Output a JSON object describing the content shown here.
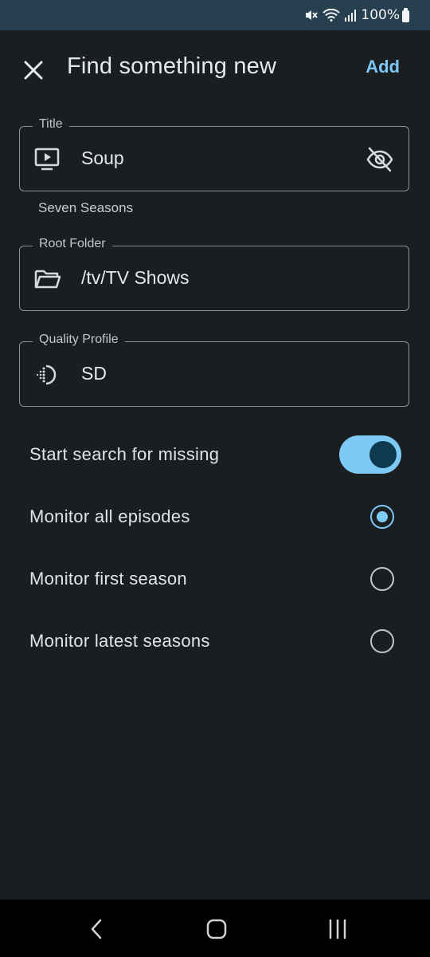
{
  "status_bar": {
    "battery_text": "100%",
    "icons": [
      "mute-icon",
      "wifi-icon",
      "signal-icon",
      "battery-icon"
    ]
  },
  "app_bar": {
    "title": "Find something new",
    "add_label": "Add",
    "close_icon": "close-icon"
  },
  "form": {
    "title_field": {
      "label": "Title",
      "value": "Soup",
      "helper": "Seven Seasons",
      "icon": "tv-play-icon",
      "trailing_icon": "eye-off-icon"
    },
    "root_folder": {
      "label": "Root Folder",
      "value": "/tv/TV Shows",
      "icon": "folder-icon"
    },
    "quality_profile": {
      "label": "Quality Profile",
      "value": "SD",
      "icon": "quality-icon"
    }
  },
  "options": {
    "search_missing": {
      "label": "Start search for missing",
      "enabled": true
    },
    "monitor": [
      {
        "label": "Monitor all episodes",
        "selected": true
      },
      {
        "label": "Monitor first season",
        "selected": false
      },
      {
        "label": "Monitor latest seasons",
        "selected": false
      }
    ]
  },
  "colors": {
    "background": "#1b1e21",
    "accent": "#7dcaf7",
    "status_bar": "#26404f"
  }
}
